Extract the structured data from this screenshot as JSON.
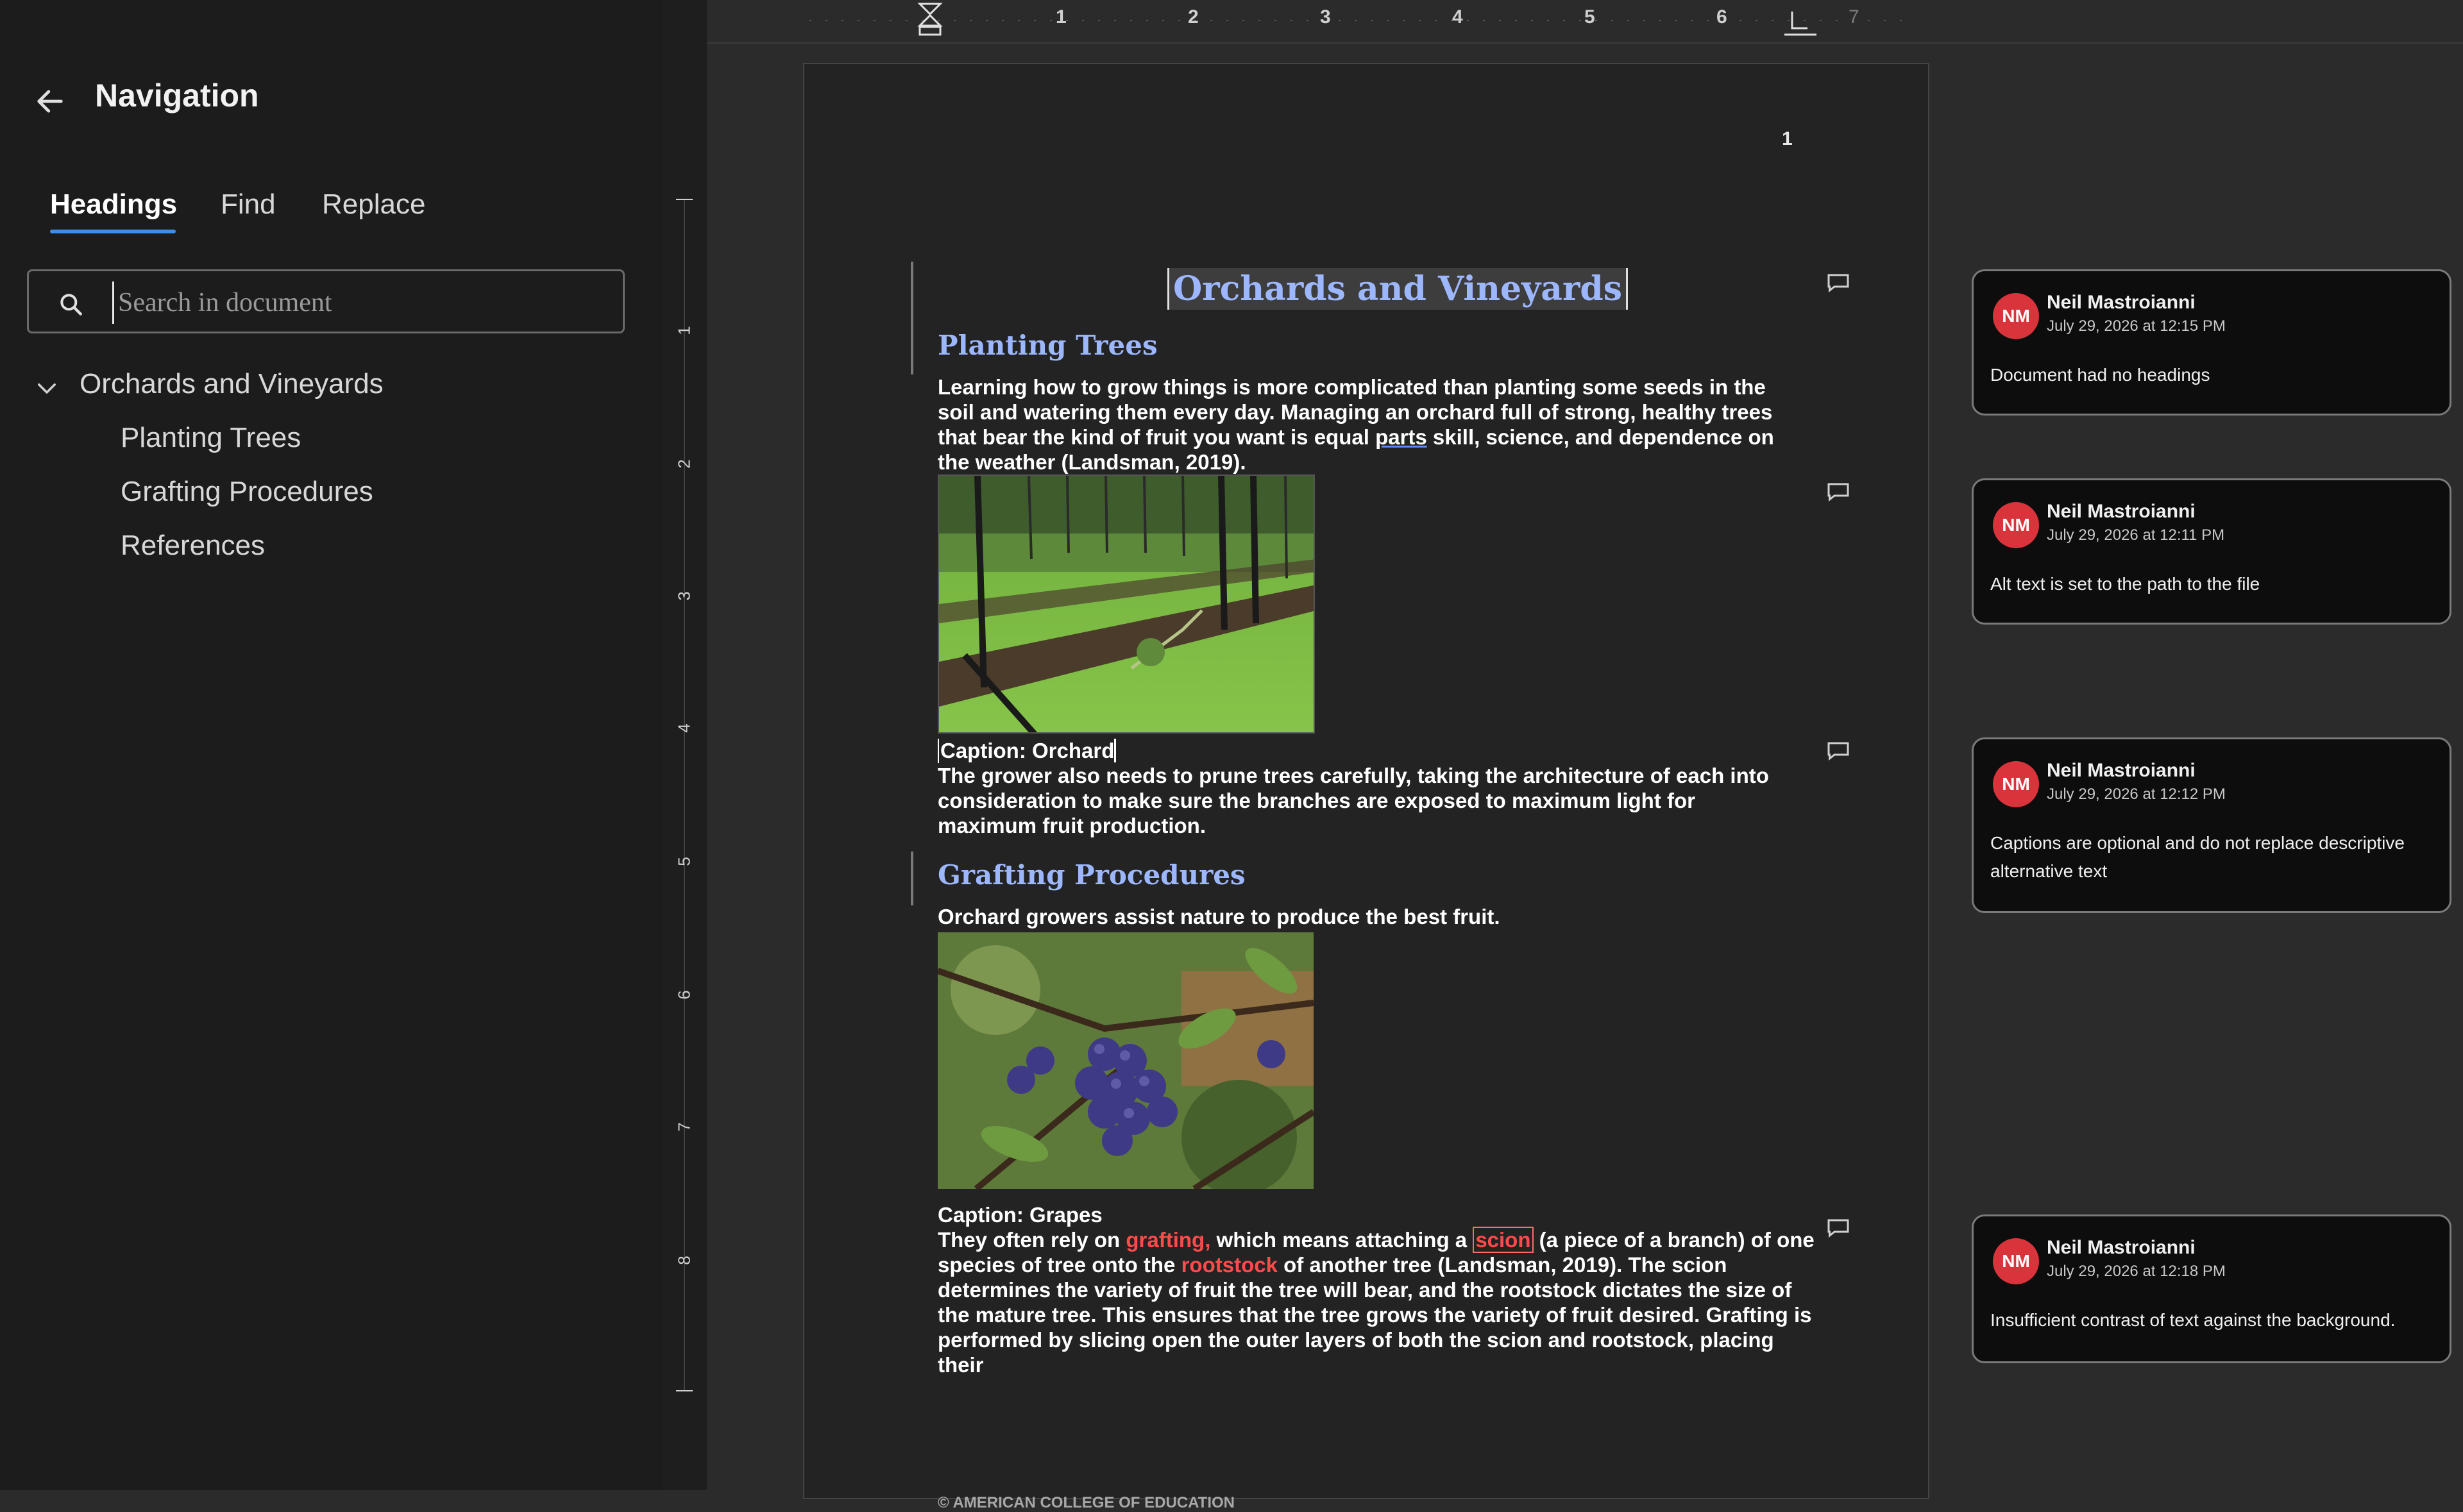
{
  "navigation": {
    "title": "Navigation",
    "tabs": [
      {
        "label": "Headings",
        "active": true
      },
      {
        "label": "Find",
        "active": false
      },
      {
        "label": "Replace",
        "active": false
      }
    ],
    "search": {
      "placeholder": "Search in document",
      "value": ""
    },
    "tree": {
      "root": "Orchards and Vineyards",
      "children": [
        "Planting Trees",
        "Grafting Procedures",
        "References"
      ]
    }
  },
  "ruler": {
    "horizontal": [
      "1",
      "2",
      "3",
      "4",
      "5",
      "6",
      "7"
    ],
    "vertical": [
      "1",
      "2",
      "3",
      "4",
      "5",
      "6",
      "7",
      "8"
    ]
  },
  "document": {
    "page_number": "1",
    "title": "Orchards and Vineyards",
    "heading1": "Planting Trees",
    "para1_before": "Learning how to grow things is more complicated than planting some seeds in the soil and watering them every day. Managing an orchard full of strong, healthy trees that bear the kind of fruit you want is equal ",
    "para1_link": "parts",
    "para1_after": " skill, science, and dependence on the weather (Landsman, 2019).",
    "caption1": "Caption: Orchard",
    "para2": "The grower also needs to prune trees carefully, taking the architecture of each into consideration to make sure the branches are exposed to maximum light for maximum fruit production.",
    "heading2": "Grafting Procedures",
    "para3": "Orchard growers assist nature to produce the best fruit.",
    "caption2": "Caption: Grapes",
    "para4_a": "They often rely on ",
    "para4_red1": "grafting,",
    "para4_b": " which means attaching a ",
    "para4_boxed": "scion",
    "para4_c": " (a piece of a branch) of one species of tree onto the ",
    "para4_red2": "rootstock",
    "para4_d": " of another tree (Landsman, 2019). The scion determines the variety of fruit the tree will bear, and the rootstock dictates the size of the mature tree. This ensures that the tree grows the variety of fruit desired. Grafting is performed by slicing open the outer layers of both the scion and rootstock, placing their",
    "footer": "© AMERICAN COLLEGE OF EDUCATION"
  },
  "comments": [
    {
      "initials": "NM",
      "author": "Neil Mastroianni",
      "date": "July 29, 2026 at 12:15 PM",
      "text": "Document had no headings"
    },
    {
      "initials": "NM",
      "author": "Neil Mastroianni",
      "date": "July 29, 2026 at 12:11 PM",
      "text": "Alt text is set to the path to the file"
    },
    {
      "initials": "NM",
      "author": "Neil Mastroianni",
      "date": "July 29, 2026 at 12:12 PM",
      "text": "Captions are optional and do not replace descriptive alternative text"
    },
    {
      "initials": "NM",
      "author": "Neil Mastroianni",
      "date": "July 29, 2026 at 12:18 PM",
      "text": "Insufficient contrast of text against the background."
    }
  ],
  "colors": {
    "accent": "#3b8fe6",
    "heading": "#9db7ff",
    "avatar": "#d9343b",
    "error_text": "#ff4b4b"
  }
}
